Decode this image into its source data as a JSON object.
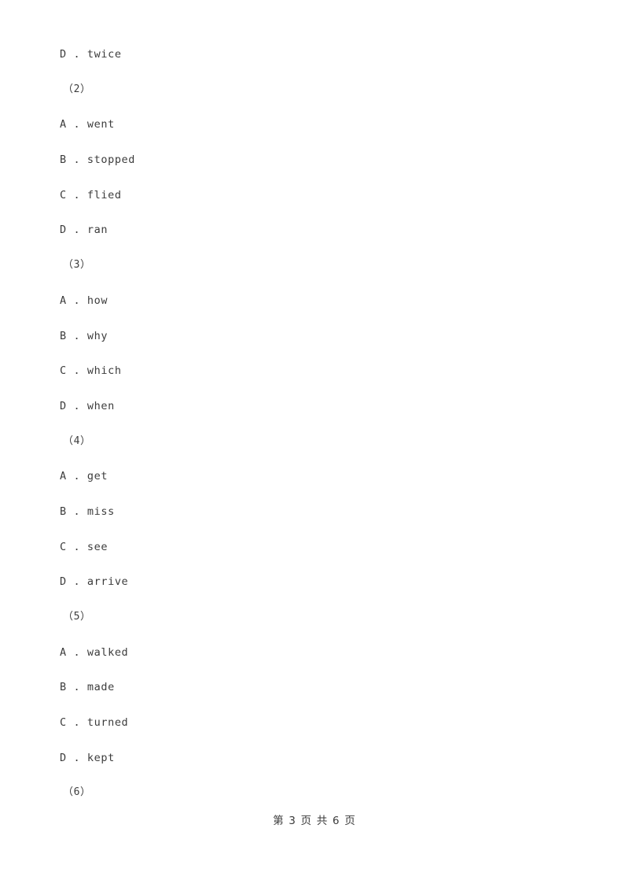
{
  "document": {
    "page_background": "#ffffff",
    "text_color": "#3c3c3c"
  },
  "content_lines": [
    {
      "kind": "option",
      "letter": "D",
      "separator": " . ",
      "text": "twice",
      "full": "D . twice"
    },
    {
      "kind": "marker",
      "text": "（2）",
      "full": "（2）"
    },
    {
      "kind": "option",
      "letter": "A",
      "separator": " . ",
      "text": "went",
      "full": "A . went"
    },
    {
      "kind": "option",
      "letter": "B",
      "separator": " . ",
      "text": "stopped",
      "full": "B . stopped"
    },
    {
      "kind": "option",
      "letter": "C",
      "separator": " . ",
      "text": "flied",
      "full": "C . flied"
    },
    {
      "kind": "option",
      "letter": "D",
      "separator": " . ",
      "text": "ran",
      "full": "D . ran"
    },
    {
      "kind": "marker",
      "text": "（3）",
      "full": "（3）"
    },
    {
      "kind": "option",
      "letter": "A",
      "separator": " . ",
      "text": "how",
      "full": "A . how"
    },
    {
      "kind": "option",
      "letter": "B",
      "separator": " . ",
      "text": "why",
      "full": "B . why"
    },
    {
      "kind": "option",
      "letter": "C",
      "separator": " . ",
      "text": "which",
      "full": "C . which"
    },
    {
      "kind": "option",
      "letter": "D",
      "separator": " . ",
      "text": "when",
      "full": "D . when"
    },
    {
      "kind": "marker",
      "text": "（4）",
      "full": "（4）"
    },
    {
      "kind": "option",
      "letter": "A",
      "separator": " . ",
      "text": "get",
      "full": "A . get"
    },
    {
      "kind": "option",
      "letter": "B",
      "separator": " . ",
      "text": "miss",
      "full": "B . miss"
    },
    {
      "kind": "option",
      "letter": "C",
      "separator": " . ",
      "text": "see",
      "full": "C . see"
    },
    {
      "kind": "option",
      "letter": "D",
      "separator": " . ",
      "text": "arrive",
      "full": "D . arrive"
    },
    {
      "kind": "marker",
      "text": "（5）",
      "full": "（5）"
    },
    {
      "kind": "option",
      "letter": "A",
      "separator": " . ",
      "text": "walked",
      "full": "A . walked"
    },
    {
      "kind": "option",
      "letter": "B",
      "separator": " . ",
      "text": "made",
      "full": "B . made"
    },
    {
      "kind": "option",
      "letter": "C",
      "separator": " . ",
      "text": "turned",
      "full": "C . turned"
    },
    {
      "kind": "option",
      "letter": "D",
      "separator": " . ",
      "text": "kept",
      "full": "D . kept"
    },
    {
      "kind": "marker",
      "text": "（6）",
      "full": "（6）"
    }
  ],
  "footer": {
    "text": "第 3 页 共 6 页",
    "current_page": "3",
    "total_pages": "6"
  }
}
